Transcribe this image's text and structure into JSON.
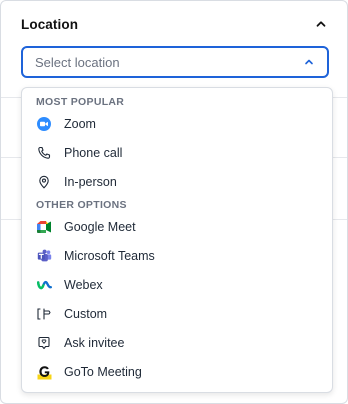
{
  "section": {
    "title": "Location"
  },
  "select": {
    "placeholder": "Select location"
  },
  "dropdown": {
    "groups": [
      {
        "label": "MOST POPULAR",
        "options": [
          {
            "label": "Zoom",
            "icon": "zoom-icon"
          },
          {
            "label": "Phone call",
            "icon": "phone-icon"
          },
          {
            "label": "In-person",
            "icon": "map-pin-icon"
          }
        ]
      },
      {
        "label": "OTHER OPTIONS",
        "options": [
          {
            "label": "Google Meet",
            "icon": "google-meet-icon"
          },
          {
            "label": "Microsoft Teams",
            "icon": "microsoft-teams-icon"
          },
          {
            "label": "Webex",
            "icon": "webex-icon"
          },
          {
            "label": "Custom",
            "icon": "custom-location-icon"
          },
          {
            "label": "Ask invitee",
            "icon": "ask-invitee-icon"
          },
          {
            "label": "GoTo Meeting",
            "icon": "goto-meeting-icon"
          }
        ]
      }
    ]
  },
  "colors": {
    "accent": "#1e63d9",
    "zoom": "#2d8cff",
    "teams": "#5b5fc7",
    "webex": "#1170cf",
    "goto": "#f7d417"
  }
}
